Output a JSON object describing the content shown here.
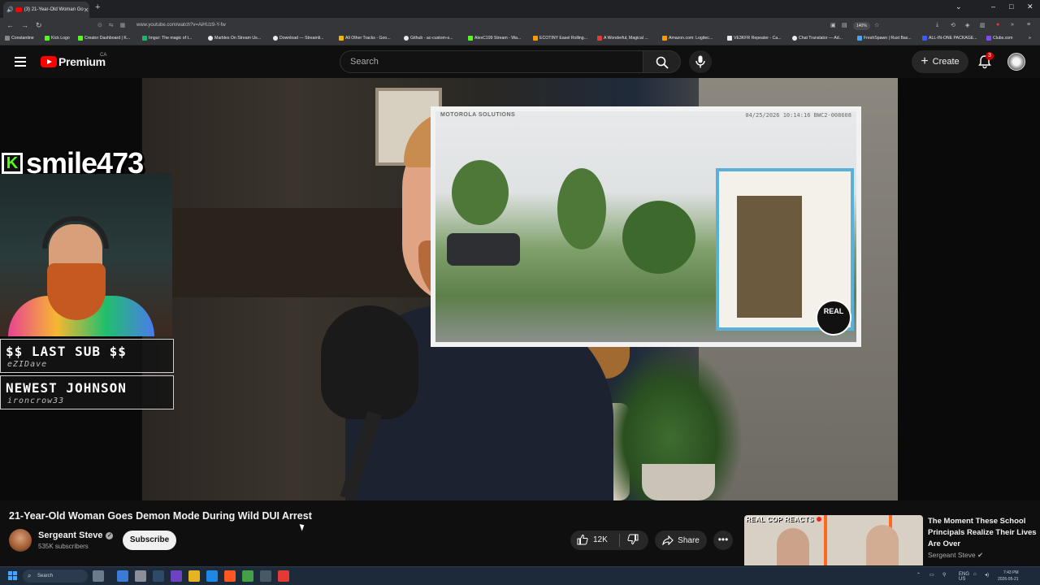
{
  "browser": {
    "tab_title": "(3) 21-Year-Old Woman Go",
    "tab_close": "✕",
    "new_tab": "+",
    "url": "www.youtube.com/watch?v=AiHUz9-Y-fw",
    "zoom": "140%",
    "window_controls": [
      "–",
      "□",
      "✕"
    ],
    "bookmarks": [
      {
        "label": "Constantine",
        "color": "#888888"
      },
      {
        "label": "Kick Logo",
        "color": "#53fc18"
      },
      {
        "label": "Creator Dashboard | K...",
        "color": "#53fc18"
      },
      {
        "label": "Imgur: The magic of t...",
        "color": "#1bb76e"
      },
      {
        "label": "Marbles On Stream Us...",
        "color": "#e8eaed"
      },
      {
        "label": "Download — Streamli...",
        "color": "#e8eaed"
      },
      {
        "label": "All Other Tracks - Goo...",
        "color": "#f4b400"
      },
      {
        "label": "Github - ac-custom-s...",
        "color": "#e8eaed"
      },
      {
        "label": "AlexC199 Stream - Wa...",
        "color": "#53fc18"
      },
      {
        "label": "ECOTINY Easel Rolling...",
        "color": "#ff9900"
      },
      {
        "label": "A Wonderful, Magical ...",
        "color": "#e53935"
      },
      {
        "label": "Amazon.com: Logitec...",
        "color": "#ff9900"
      },
      {
        "label": "VE3KFR Repeater - Ca...",
        "color": "#e8eaed"
      },
      {
        "label": "Chat Translator — Ad...",
        "color": "#e8eaed"
      },
      {
        "label": "FreshSpawn | Rust Bas...",
        "color": "#4aa3ff"
      },
      {
        "label": "ALL-IN-ONE PACKAGE...",
        "color": "#3d5afe"
      },
      {
        "label": "Clubs.com",
        "color": "#7c4dff"
      }
    ]
  },
  "youtube": {
    "logo_text": "Premium",
    "country_code": "CA",
    "search_placeholder": "Search",
    "create_label": "Create",
    "notification_count": "3"
  },
  "overlay": {
    "kick_letter": "K",
    "streamer_name": "smile473",
    "last_sub_title": "$$ LAST SUB $$",
    "last_sub_name": "eZIDave",
    "newest_title": "NEWEST JOHNSON",
    "newest_name": "ironcrow33"
  },
  "inset": {
    "brand": "MOTOROLA SOLUTIONS",
    "timestamp": "04/25/2026 10:14:16  BWC2-008608",
    "logo_text": "REAL"
  },
  "video": {
    "title": "21-Year-Old Woman Goes Demon Mode During Wild DUI Arrest",
    "channel_name": "Sergeant Steve",
    "subscribers": "535K subscribers",
    "subscribe_label": "Subscribe",
    "like_count": "12K",
    "share_label": "Share",
    "more_label": "•••"
  },
  "recommendation": {
    "thumb_label": "REAL COP REACTS",
    "title": "The Moment These School Principals Realize Their Lives Are Over",
    "channel": "Sergeant Steve"
  },
  "taskbar": {
    "search_label": "Search",
    "lang": "ENG",
    "region": "US",
    "time": "7:43 PM",
    "date": "2026-05-21"
  },
  "colors": {
    "youtube_red": "#ff0000",
    "kick_green": "#53fc18",
    "background": "#0f0f0f"
  }
}
